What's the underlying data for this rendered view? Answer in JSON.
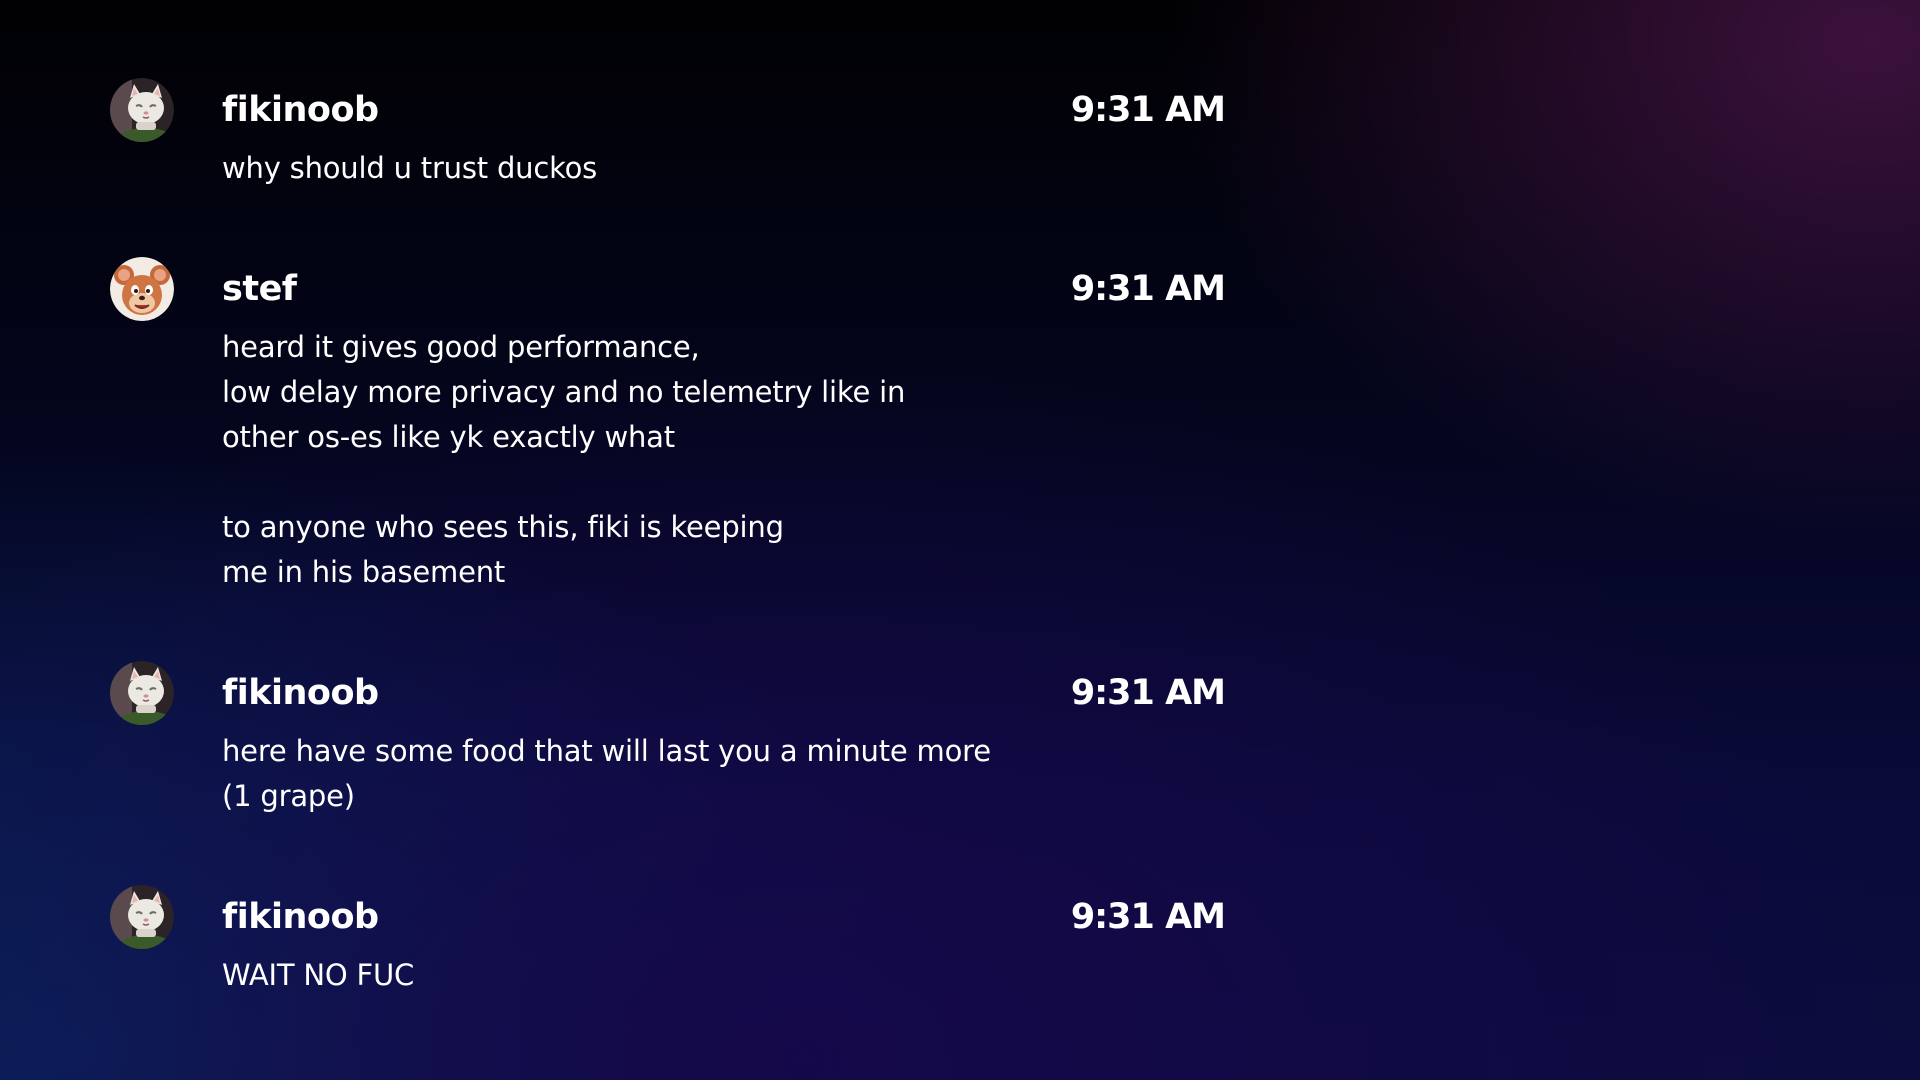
{
  "messages": [
    {
      "author": "fikinoob",
      "avatar": "white-cat-avatar",
      "time": "9:31 AM",
      "lines": [
        "why should u trust duckos"
      ]
    },
    {
      "author": "stef",
      "avatar": "cartoon-mouse-avatar",
      "time": "9:31 AM",
      "lines": [
        "heard it gives good performance,",
        "low delay more privacy and no telemetry like in",
        "other os-es like yk exactly what",
        "",
        "to anyone who sees this, fiki is keeping",
        "me in his basement"
      ]
    },
    {
      "author": "fikinoob",
      "avatar": "white-cat-avatar",
      "time": "9:31 AM",
      "lines": [
        "here have some food that will last you a minute more",
        "(1 grape)"
      ]
    },
    {
      "author": "fikinoob",
      "avatar": "white-cat-avatar",
      "time": "9:31 AM",
      "lines": [
        "WAIT NO FUC"
      ]
    }
  ],
  "colors": {
    "text": "#ffffff",
    "background_top": "#010103",
    "background_bottom": "#0c0c3e",
    "accent_glow": "#461446"
  }
}
